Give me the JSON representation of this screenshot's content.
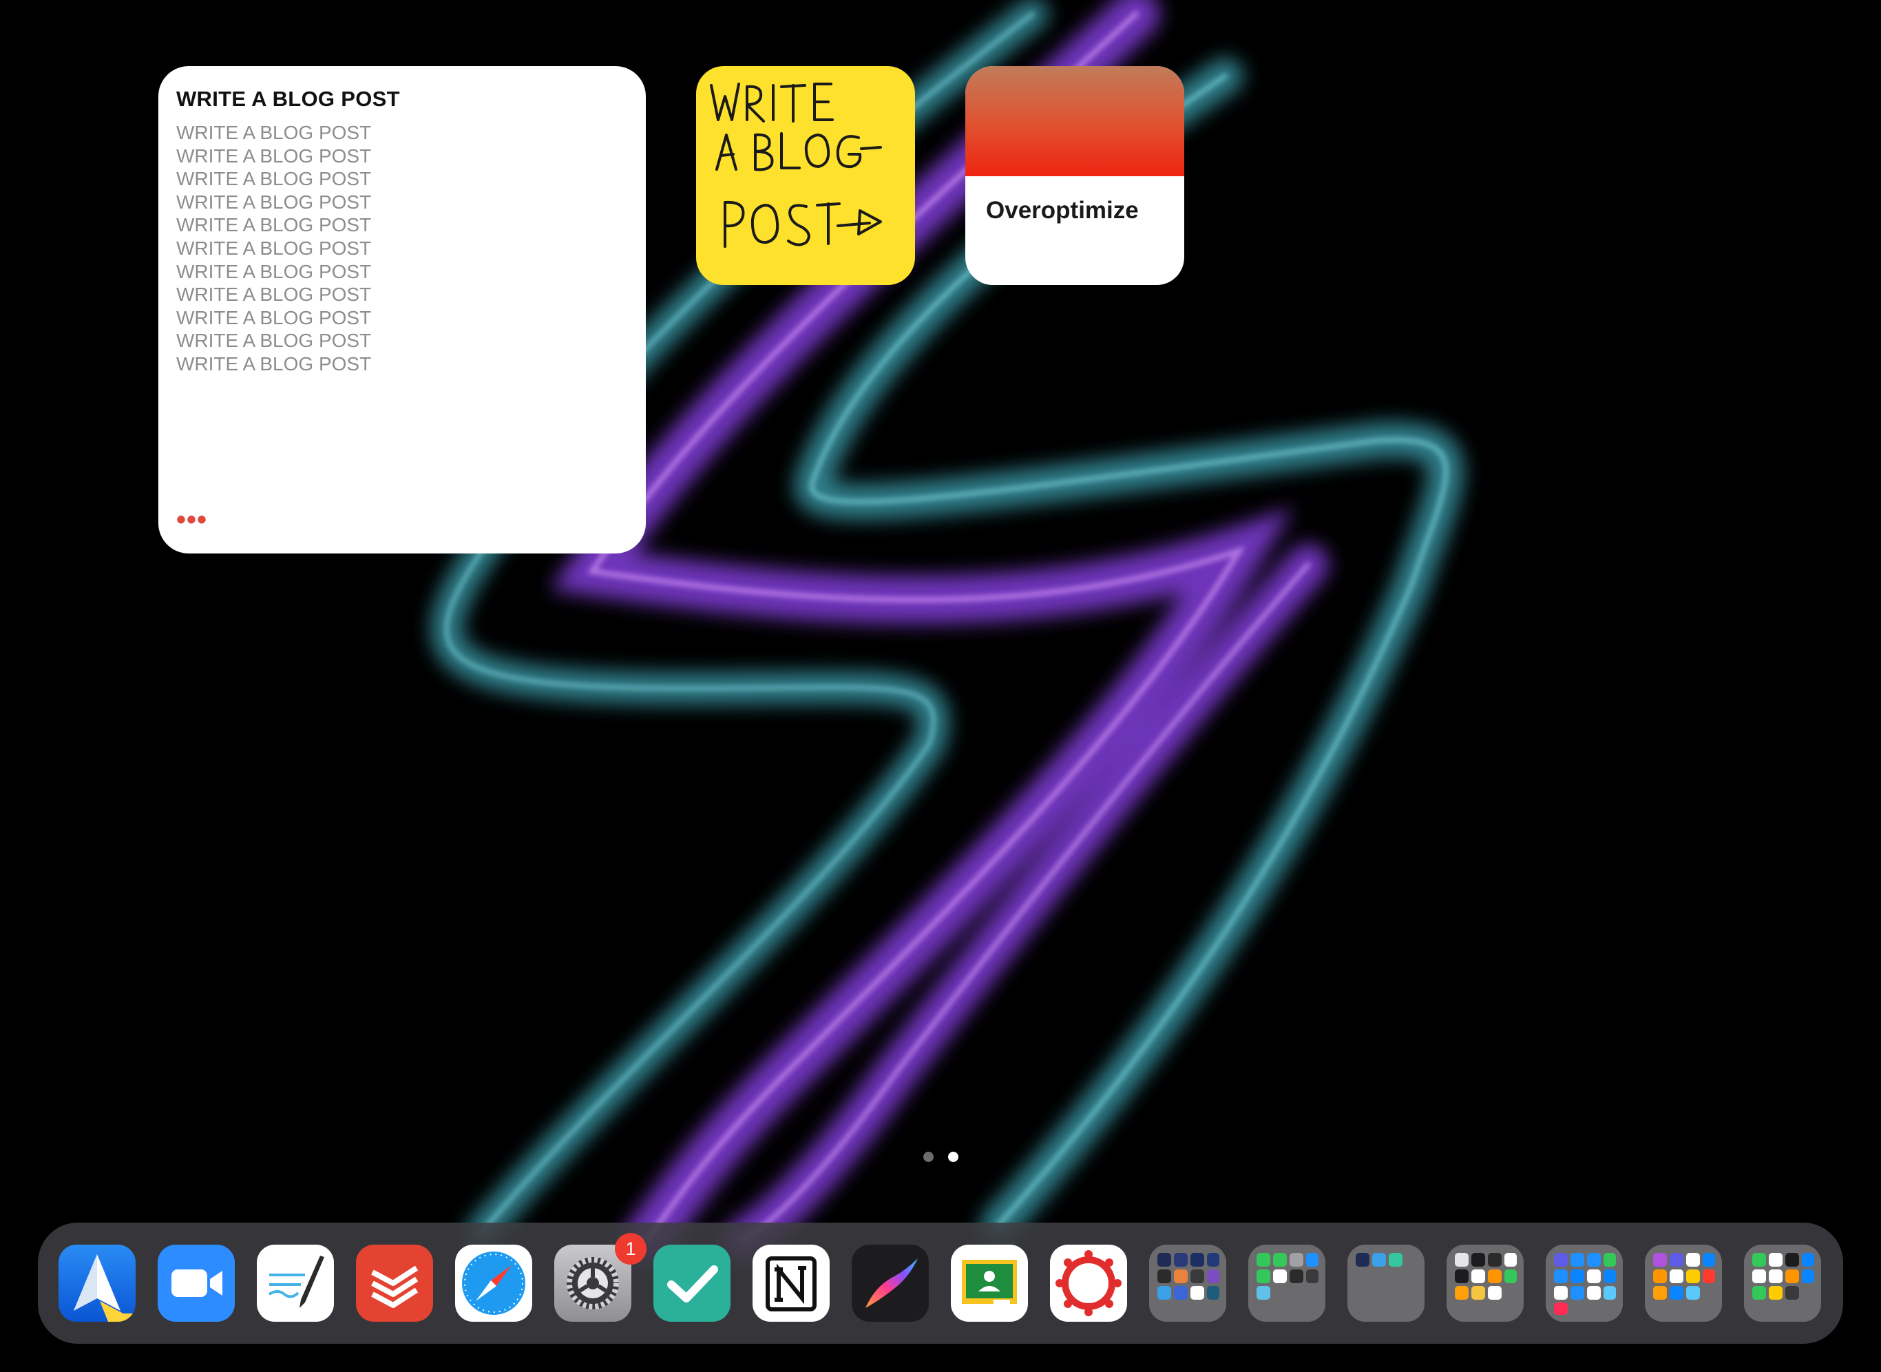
{
  "notes_widget": {
    "title": "WRITE A BLOG POST",
    "lines": [
      "WRITE A BLOG POST",
      "WRITE A BLOG POST",
      "WRITE A BLOG POST",
      "WRITE A BLOG POST",
      "WRITE A BLOG POST",
      "WRITE A BLOG POST",
      "WRITE A BLOG POST",
      "WRITE A BLOG POST",
      "WRITE A BLOG POST",
      "WRITE A BLOG POST",
      "WRITE A BLOG POST"
    ],
    "more": "•••"
  },
  "sticky_widget": {
    "handwriting": "WRITE A BLOG POST→",
    "color": "#fde12d"
  },
  "streak_widget": {
    "label": "Overoptimize"
  },
  "page_indicator": {
    "pages": 2,
    "current": 2
  },
  "dock": {
    "apps": [
      {
        "name": "Spark",
        "icon": "paper-plane-icon"
      },
      {
        "name": "Zoom",
        "icon": "video-camera-icon"
      },
      {
        "name": "GoodNotes",
        "icon": "pen-paper-icon"
      },
      {
        "name": "Todoist",
        "icon": "todoist-icon"
      },
      {
        "name": "Safari",
        "icon": "compass-icon"
      },
      {
        "name": "Settings",
        "icon": "gear-icon",
        "badge": "1"
      },
      {
        "name": "Tick",
        "icon": "checkmark-icon"
      },
      {
        "name": "Notion",
        "icon": "notion-icon"
      },
      {
        "name": "Procreate",
        "icon": "brush-stroke-icon"
      },
      {
        "name": "Google Classroom",
        "icon": "classroom-icon"
      },
      {
        "name": "Canvas",
        "icon": "canvas-icon"
      }
    ],
    "folders": 7
  },
  "colors": {
    "accent_red": "#e0483b",
    "badge_red": "#ef3a2f",
    "sticky_yellow": "#fde12d",
    "wallpaper_purple": "#9b5cff",
    "wallpaper_teal": "#5fd0e0"
  }
}
